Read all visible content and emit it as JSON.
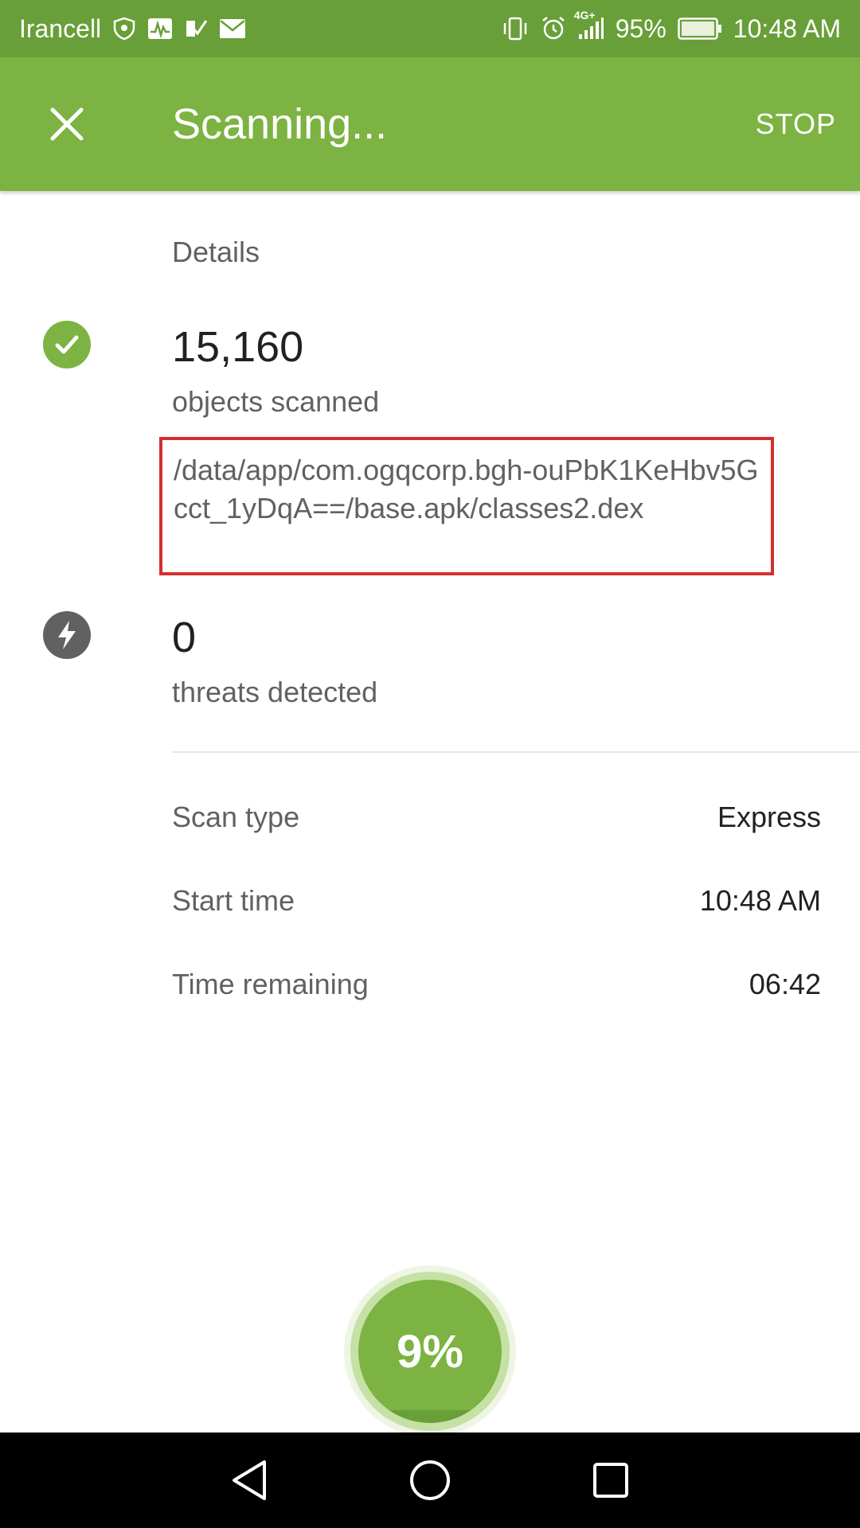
{
  "status_bar": {
    "carrier": "Irancell",
    "network": "4G+",
    "battery": "95%",
    "time": "10:48 AM"
  },
  "app_bar": {
    "title": "Scanning...",
    "stop_label": "STOP"
  },
  "details": {
    "section_label": "Details",
    "objects": {
      "value": "15,160",
      "caption": "objects scanned"
    },
    "current_path": "/data/app/com.ogqcorp.bgh-ouPbK1KeHbv5Gcct_1yDqA==/base.apk/classes2.dex",
    "threats": {
      "value": "0",
      "caption": "threats detected"
    }
  },
  "info": {
    "scan_type": {
      "label": "Scan type",
      "value": "Express"
    },
    "start_time": {
      "label": "Start time",
      "value": "10:48 AM"
    },
    "time_remaining": {
      "label": "Time remaining",
      "value": "06:42"
    }
  },
  "progress": {
    "percent_label": "9%",
    "fraction": 0.09
  },
  "colors": {
    "accent": "#7cb342",
    "status_bar": "#689f38",
    "highlight_border": "#d32f2f",
    "icon_gray": "#616161"
  },
  "icons": {
    "close": "close-icon",
    "ok": "check-circle-icon",
    "threat": "lightning-bolt-icon",
    "nav_back": "back-triangle-icon",
    "nav_home": "home-circle-icon",
    "nav_recents": "recents-square-icon"
  }
}
